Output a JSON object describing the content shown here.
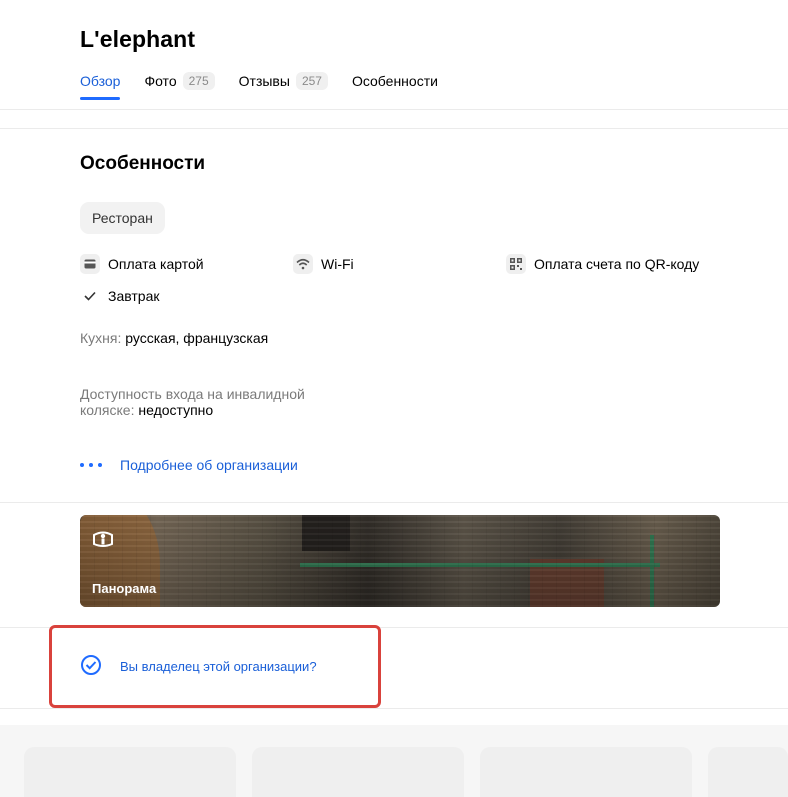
{
  "header": {
    "title": "L'elephant",
    "tabs": [
      {
        "label": "Обзор",
        "count": ""
      },
      {
        "label": "Фото",
        "count": "275"
      },
      {
        "label": "Отзывы",
        "count": "257"
      },
      {
        "label": "Особенности",
        "count": ""
      }
    ]
  },
  "features": {
    "title": "Особенности",
    "chip": "Ресторан",
    "items": [
      {
        "label": "Оплата картой",
        "icon": "card-icon"
      },
      {
        "label": "Wi-Fi",
        "icon": "wifi-icon"
      },
      {
        "label": "Оплата счета по QR-коду",
        "icon": "qr-icon"
      },
      {
        "label": "Завтрак",
        "icon": "check-icon"
      }
    ],
    "cuisine": {
      "key": "Кухня:",
      "value": "русская, французская"
    },
    "wheelchair": {
      "key_line1": "Доступность входа на инвалидной",
      "key_line2": "коляске:",
      "value": "недоступно"
    },
    "more_link": "Подробнее об организации"
  },
  "panorama": {
    "label": "Панорама",
    "icon": "panorama-icon"
  },
  "owner": {
    "label": "Вы владелец этой организации?",
    "icon": "check-circle-icon",
    "highlight_color": "#d9423c"
  },
  "colors": {
    "accent": "#1f6bff",
    "link": "#1a5fd8"
  }
}
